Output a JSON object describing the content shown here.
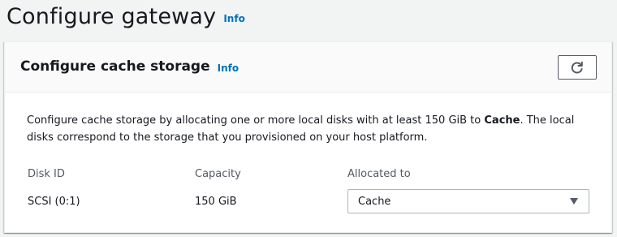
{
  "page": {
    "title": "Configure gateway",
    "info_label": "Info"
  },
  "panel": {
    "title": "Configure cache storage",
    "info_label": "Info",
    "refresh_icon": "refresh-icon",
    "description_prefix": "Configure cache storage by allocating one or more local disks with at least 150 GiB to ",
    "description_bold": "Cache",
    "description_suffix": ". The local disks correspond to the storage that you provisioned on your host platform.",
    "columns": {
      "disk_id": "Disk ID",
      "capacity": "Capacity",
      "allocated_to": "Allocated to"
    },
    "rows": [
      {
        "disk_id": "SCSI (0:1)",
        "capacity": "150 GiB",
        "allocated_to": "Cache"
      }
    ]
  },
  "colors": {
    "background": "#f2f3f3",
    "link": "#0073bb",
    "text": "#16191f",
    "muted_text": "#545b64"
  }
}
